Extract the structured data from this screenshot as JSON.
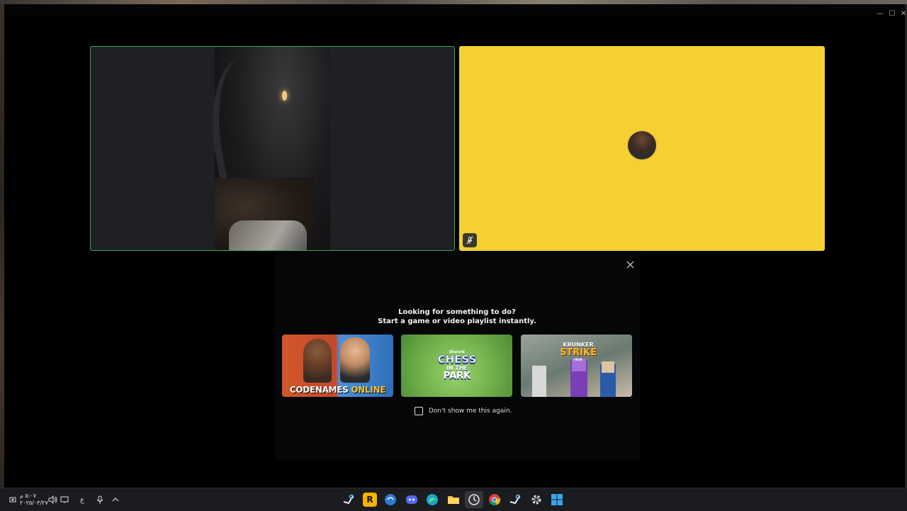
{
  "window": {
    "minimize_glyph": "—",
    "maximize_glyph": "☐",
    "close_glyph": "✕"
  },
  "call": {
    "participants": [
      {
        "kind": "video",
        "speaking": true,
        "border_color": "#3ba55d"
      },
      {
        "kind": "avatar",
        "tile_color": "#f5d033",
        "muted": true
      }
    ]
  },
  "activity_prompt": {
    "title_line1": "Looking for something to do?",
    "title_line2": "Start a game or video playlist instantly.",
    "close_icon": "close-icon",
    "cards": [
      {
        "name": "Codenames Online",
        "text_main": "CODENAMES",
        "text_accent": "ONLINE"
      },
      {
        "name": "Chess in the Park",
        "brand": "Discord",
        "line1": "CHESS",
        "line2": "IN THE",
        "line3": "PARK"
      },
      {
        "name": "Krunker Strike",
        "line1": "KRUNKER",
        "line2": "STRIKE",
        "line3": "FRVR"
      }
    ],
    "dont_show_label": "Don't show me this again.",
    "dont_show_checked": false
  },
  "taskbar": {
    "clock_time": "٥:٠٧ م",
    "clock_date": "٢٠٢٥/٠٣/٢٧",
    "input_lang": "ع",
    "apps": [
      {
        "name": "steam",
        "icon": "steam-icon"
      },
      {
        "name": "rockstar",
        "icon": "rockstar-icon",
        "glyph": "R"
      },
      {
        "name": "edge-dev",
        "icon": "edge-dev-icon"
      },
      {
        "name": "discord",
        "icon": "discord-icon"
      },
      {
        "name": "edge",
        "icon": "edge-icon"
      },
      {
        "name": "file-explorer",
        "icon": "folder-icon"
      },
      {
        "name": "clock",
        "icon": "clock-icon",
        "active": true
      },
      {
        "name": "chrome",
        "icon": "chrome-icon"
      },
      {
        "name": "steam-2",
        "icon": "steam-icon"
      },
      {
        "name": "settings",
        "icon": "gear-icon"
      },
      {
        "name": "start",
        "icon": "windows-icon"
      }
    ]
  }
}
